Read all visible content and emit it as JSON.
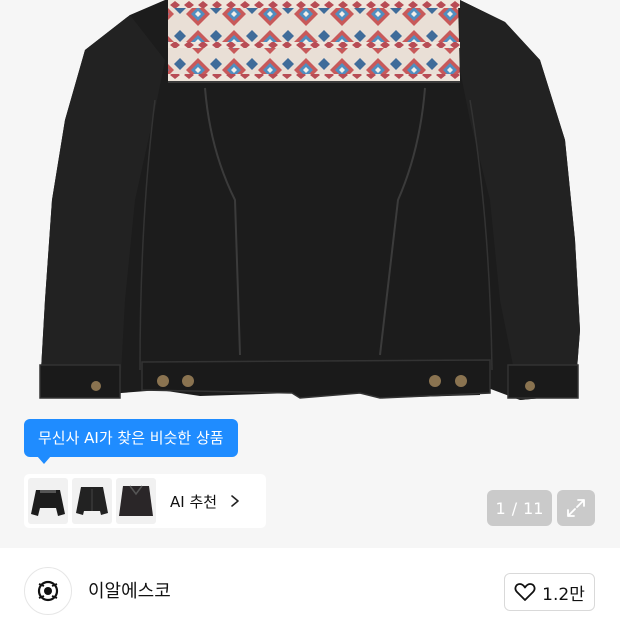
{
  "ai_recommend": {
    "tooltip": "무신사 AI가 찾은 비슷한 상품",
    "label": "AI 추천",
    "thumbnails": [
      "thumb-jacket-1",
      "thumb-jacket-2",
      "thumb-jacket-3"
    ]
  },
  "pager": {
    "current": "1",
    "separator": "/",
    "total": "11"
  },
  "brand": {
    "name": "이알에스코"
  },
  "like": {
    "count": "1.2만"
  },
  "colors": {
    "accent": "#1f8cff",
    "jacket": "#1c1c1c",
    "background": "#f6f6f6"
  },
  "icons": [
    "expand-icon",
    "heart-icon",
    "chevron-right-icon",
    "brand-logo-icon"
  ]
}
